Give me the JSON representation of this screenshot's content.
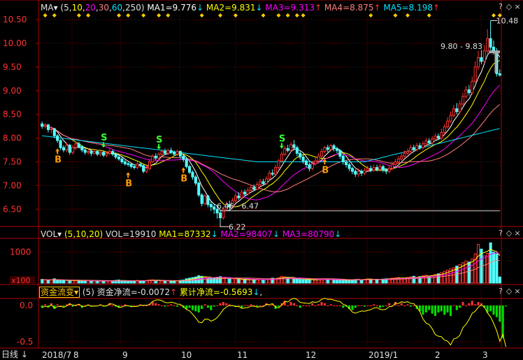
{
  "colors": {
    "bg": "#000000",
    "grid": "#7a0000",
    "axis": "#b00000",
    "up": "#ff3232",
    "down": "#54ffff",
    "ma1": "#ffffff",
    "ma2": "#ffff00",
    "ma3": "#ff00ff",
    "ma4": "#ff8080",
    "ma5": "#00e5ff",
    "buy": "#ff9900",
    "sell": "#33ff33",
    "diamond": "#ffcc00"
  },
  "price_header": {
    "indicator": "MA",
    "params_open": "(5,",
    "p1": "10",
    "p2": "20",
    "p3": "30",
    "p4": "60",
    "p5": "250)",
    "ma1": "MA1=9.776",
    "ma2": "MA2=9.831",
    "ma3": "MA3=9.313",
    "ma4": "MA4=8.875",
    "ma5": "MA5=8.198"
  },
  "vol_header": {
    "indicator": "VOL",
    "params": "(5,10,20)",
    "vol": "VOL=19910",
    "ma1": "MA1=87332",
    "ma2": "MA2=98407",
    "ma3": "MA3=80790"
  },
  "flow_header": {
    "indicator": "资金流变",
    "params": "(5)",
    "net": "资金净流=-0.0072",
    "cum": "累计净流=-0.5693"
  },
  "price_axis": [
    "10.50",
    "10.00",
    "9.50",
    "9.00",
    "8.50",
    "8.00",
    "7.50",
    "7.00",
    "6.50"
  ],
  "vol_axis": [
    "1000",
    "x100"
  ],
  "flow_axis": [
    "0.0",
    "-0.5"
  ],
  "time_axis": {
    "mode_label": "日线",
    "labels": [
      "2018/7",
      "8",
      "9",
      "10",
      "11",
      "12",
      "2019/1",
      "2",
      "3"
    ]
  },
  "annotations": {
    "high": "10.48",
    "range_high": "9.80 - 9.83",
    "range_low": "6.46 - 6.47",
    "low": "6.22"
  },
  "markers": {
    "buy": "B",
    "sell": "S"
  },
  "chart_data": {
    "type": "candlestick",
    "price_range": [
      6.15,
      10.62
    ],
    "candles": [
      [
        8.3,
        8.25,
        8.35,
        8.2
      ],
      [
        8.25,
        8.28,
        8.32,
        8.2
      ],
      [
        8.28,
        8.18,
        8.3,
        8.12
      ],
      [
        8.18,
        8.2,
        8.25,
        8.1
      ],
      [
        8.2,
        8.05,
        8.22,
        8.0
      ],
      [
        8.05,
        7.95,
        8.08,
        7.9
      ],
      [
        7.95,
        7.8,
        7.98,
        7.75
      ],
      [
        7.8,
        7.75,
        7.85,
        7.7
      ],
      [
        7.75,
        7.85,
        7.9,
        7.7
      ],
      [
        7.85,
        7.7,
        7.88,
        7.65
      ],
      [
        7.7,
        7.8,
        7.85,
        7.65
      ],
      [
        7.8,
        7.88,
        7.92,
        7.75
      ],
      [
        7.88,
        7.82,
        7.92,
        7.78
      ],
      [
        7.82,
        7.75,
        7.85,
        7.7
      ],
      [
        7.75,
        7.7,
        7.78,
        7.65
      ],
      [
        7.7,
        7.72,
        7.78,
        7.65
      ],
      [
        7.72,
        7.68,
        7.76,
        7.62
      ],
      [
        7.68,
        7.72,
        7.76,
        7.65
      ],
      [
        7.72,
        7.66,
        7.75,
        7.62
      ],
      [
        7.66,
        7.7,
        7.74,
        7.62
      ],
      [
        7.7,
        7.64,
        7.74,
        7.6
      ],
      [
        7.64,
        7.68,
        7.72,
        7.6
      ],
      [
        7.68,
        7.72,
        7.78,
        7.64
      ],
      [
        7.72,
        7.66,
        7.76,
        7.62
      ],
      [
        7.66,
        7.6,
        7.7,
        7.56
      ],
      [
        7.6,
        7.56,
        7.64,
        7.52
      ],
      [
        7.56,
        7.5,
        7.6,
        7.46
      ],
      [
        7.5,
        7.46,
        7.54,
        7.42
      ],
      [
        7.46,
        7.45,
        7.5,
        7.4
      ],
      [
        7.45,
        7.4,
        7.48,
        7.36
      ],
      [
        7.4,
        7.38,
        7.44,
        7.34
      ],
      [
        7.38,
        7.45,
        7.5,
        7.34
      ],
      [
        7.45,
        7.42,
        7.48,
        7.38
      ],
      [
        7.42,
        7.3,
        7.45,
        7.26
      ],
      [
        7.3,
        7.36,
        7.42,
        7.26
      ],
      [
        7.36,
        7.5,
        7.56,
        7.32
      ],
      [
        7.5,
        7.62,
        7.66,
        7.48
      ],
      [
        7.62,
        7.58,
        7.68,
        7.54
      ],
      [
        7.58,
        7.66,
        7.7,
        7.54
      ],
      [
        7.66,
        7.72,
        7.76,
        7.62
      ],
      [
        7.72,
        7.68,
        7.78,
        7.64
      ],
      [
        7.68,
        7.74,
        7.78,
        7.64
      ],
      [
        7.74,
        7.7,
        7.8,
        7.66
      ],
      [
        7.7,
        7.66,
        7.74,
        7.62
      ],
      [
        7.66,
        7.72,
        7.76,
        7.62
      ],
      [
        7.72,
        7.62,
        7.74,
        7.56
      ],
      [
        7.62,
        7.55,
        7.66,
        7.5
      ],
      [
        7.55,
        7.4,
        7.58,
        7.36
      ],
      [
        7.4,
        7.28,
        7.44,
        7.24
      ],
      [
        7.28,
        7.18,
        7.32,
        7.12
      ],
      [
        7.18,
        7.05,
        7.22,
        7.0
      ],
      [
        7.05,
        6.8,
        7.08,
        6.76
      ],
      [
        6.8,
        6.62,
        6.84,
        6.56
      ],
      [
        6.62,
        6.78,
        6.82,
        6.58
      ],
      [
        6.78,
        6.6,
        6.8,
        6.54
      ],
      [
        6.6,
        6.55,
        6.66,
        6.46
      ],
      [
        6.55,
        6.5,
        6.6,
        6.4
      ],
      [
        6.5,
        6.42,
        6.56,
        6.3
      ],
      [
        6.42,
        6.32,
        6.48,
        6.22
      ],
      [
        6.32,
        6.5,
        6.56,
        6.28
      ],
      [
        6.5,
        6.6,
        6.66,
        6.46
      ],
      [
        6.6,
        6.55,
        6.68,
        6.5
      ],
      [
        6.55,
        6.68,
        6.74,
        6.52
      ],
      [
        6.68,
        6.78,
        6.84,
        6.64
      ],
      [
        6.78,
        6.74,
        6.86,
        6.7
      ],
      [
        6.74,
        6.86,
        6.92,
        6.72
      ],
      [
        6.86,
        6.82,
        6.92,
        6.78
      ],
      [
        6.82,
        6.9,
        6.96,
        6.78
      ],
      [
        6.9,
        6.96,
        7.02,
        6.86
      ],
      [
        6.96,
        6.92,
        7.02,
        6.88
      ],
      [
        6.92,
        7.02,
        7.08,
        6.9
      ],
      [
        7.02,
        7.08,
        7.14,
        6.98
      ],
      [
        7.08,
        7.04,
        7.14,
        7.0
      ],
      [
        7.04,
        7.14,
        7.2,
        7.02
      ],
      [
        7.14,
        7.26,
        7.32,
        7.1
      ],
      [
        7.26,
        7.24,
        7.34,
        7.2
      ],
      [
        7.24,
        7.38,
        7.44,
        7.2
      ],
      [
        7.38,
        7.52,
        7.56,
        7.34
      ],
      [
        7.52,
        7.66,
        7.72,
        7.48
      ],
      [
        7.66,
        7.78,
        7.84,
        7.62
      ],
      [
        7.78,
        7.74,
        7.86,
        7.7
      ],
      [
        7.74,
        7.86,
        7.92,
        7.7
      ],
      [
        7.86,
        7.8,
        7.96,
        7.74
      ],
      [
        7.8,
        7.68,
        7.84,
        7.62
      ],
      [
        7.68,
        7.6,
        7.72,
        7.54
      ],
      [
        7.6,
        7.52,
        7.66,
        7.46
      ],
      [
        7.52,
        7.44,
        7.56,
        7.38
      ],
      [
        7.44,
        7.36,
        7.48,
        7.3
      ],
      [
        7.36,
        7.46,
        7.52,
        7.32
      ],
      [
        7.46,
        7.52,
        7.58,
        7.42
      ],
      [
        7.52,
        7.62,
        7.68,
        7.48
      ],
      [
        7.62,
        7.72,
        7.78,
        7.58
      ],
      [
        7.72,
        7.8,
        7.84,
        7.68
      ],
      [
        7.8,
        7.76,
        7.86,
        7.7
      ],
      [
        7.76,
        7.84,
        7.88,
        7.72
      ],
      [
        7.84,
        7.78,
        7.88,
        7.72
      ],
      [
        7.78,
        7.74,
        7.82,
        7.68
      ],
      [
        7.74,
        7.62,
        7.76,
        7.56
      ],
      [
        7.62,
        7.5,
        7.66,
        7.44
      ],
      [
        7.5,
        7.44,
        7.54,
        7.38
      ],
      [
        7.44,
        7.36,
        7.48,
        7.3
      ],
      [
        7.36,
        7.3,
        7.4,
        7.24
      ],
      [
        7.3,
        7.24,
        7.34,
        7.18
      ],
      [
        7.24,
        7.3,
        7.36,
        7.18
      ],
      [
        7.3,
        7.26,
        7.34,
        7.2
      ],
      [
        7.26,
        7.32,
        7.38,
        7.22
      ],
      [
        7.32,
        7.36,
        7.42,
        7.28
      ],
      [
        7.36,
        7.32,
        7.42,
        7.28
      ],
      [
        7.32,
        7.38,
        7.44,
        7.28
      ],
      [
        7.38,
        7.34,
        7.44,
        7.3
      ],
      [
        7.34,
        7.4,
        7.46,
        7.3
      ],
      [
        7.4,
        7.32,
        7.44,
        7.28
      ],
      [
        7.32,
        7.3,
        7.36,
        7.24
      ],
      [
        7.3,
        7.36,
        7.42,
        7.26
      ],
      [
        7.36,
        7.44,
        7.5,
        7.32
      ],
      [
        7.44,
        7.5,
        7.56,
        7.4
      ],
      [
        7.5,
        7.56,
        7.62,
        7.46
      ],
      [
        7.56,
        7.62,
        7.68,
        7.52
      ],
      [
        7.62,
        7.68,
        7.74,
        7.58
      ],
      [
        7.68,
        7.72,
        7.78,
        7.64
      ],
      [
        7.72,
        7.8,
        7.86,
        7.68
      ],
      [
        7.8,
        7.76,
        7.86,
        7.72
      ],
      [
        7.76,
        7.84,
        7.9,
        7.72
      ],
      [
        7.84,
        7.8,
        7.9,
        7.76
      ],
      [
        7.8,
        7.88,
        7.94,
        7.76
      ],
      [
        7.88,
        7.94,
        8.0,
        7.84
      ],
      [
        7.94,
        7.9,
        8.0,
        7.86
      ],
      [
        7.9,
        7.98,
        8.04,
        7.86
      ],
      [
        7.98,
        8.04,
        8.1,
        7.94
      ],
      [
        8.04,
        8.0,
        8.1,
        7.96
      ],
      [
        8.0,
        8.12,
        8.2,
        7.96
      ],
      [
        8.12,
        8.24,
        8.3,
        8.08
      ],
      [
        8.24,
        8.36,
        8.44,
        8.2
      ],
      [
        8.36,
        8.48,
        8.56,
        8.32
      ],
      [
        8.48,
        8.62,
        8.7,
        8.44
      ],
      [
        8.62,
        8.56,
        8.74,
        8.5
      ],
      [
        8.56,
        8.72,
        8.8,
        8.52
      ],
      [
        8.72,
        8.88,
        8.96,
        8.68
      ],
      [
        8.88,
        9.02,
        9.1,
        8.84
      ],
      [
        9.02,
        8.96,
        9.12,
        8.9
      ],
      [
        8.96,
        9.2,
        9.3,
        8.92
      ],
      [
        9.2,
        9.5,
        9.62,
        9.16
      ],
      [
        9.5,
        9.7,
        9.84,
        9.44
      ],
      [
        9.7,
        9.62,
        9.86,
        9.56
      ],
      [
        9.62,
        9.84,
        9.96,
        9.58
      ],
      [
        9.84,
        10.1,
        10.3,
        9.78
      ],
      [
        10.1,
        9.92,
        10.48,
        9.86
      ],
      [
        9.92,
        9.84,
        10.06,
        9.76
      ],
      [
        9.84,
        9.36,
        9.9,
        9.3
      ],
      [
        9.36,
        9.33,
        9.45,
        9.3
      ]
    ],
    "volume": [
      12,
      10,
      9,
      11,
      14,
      10,
      8,
      9,
      8,
      7,
      9,
      8,
      7,
      8,
      9,
      7,
      6,
      7,
      8,
      6,
      7,
      6,
      7,
      8,
      9,
      10,
      8,
      7,
      6,
      8,
      7,
      9,
      6,
      8,
      9,
      10,
      11,
      9,
      8,
      7,
      8,
      7,
      6,
      7,
      8,
      9,
      10,
      14,
      16,
      18,
      20,
      24,
      22,
      18,
      16,
      15,
      17,
      19,
      21,
      18,
      16,
      15,
      14,
      13,
      12,
      11,
      12,
      10,
      11,
      12,
      13,
      11,
      10,
      12,
      14,
      16,
      15,
      18,
      22,
      20,
      18,
      16,
      15,
      14,
      12,
      11,
      10,
      12,
      11,
      10,
      12,
      13,
      14,
      12,
      11,
      10,
      9,
      10,
      11,
      9,
      10,
      11,
      12,
      13,
      11,
      12,
      14,
      13,
      12,
      11,
      12,
      13,
      14,
      15,
      16,
      17,
      18,
      16,
      17,
      18,
      20,
      22,
      19,
      21,
      24,
      26,
      23,
      25,
      28,
      30,
      34,
      38,
      42,
      46,
      50,
      55,
      60,
      66,
      72,
      68,
      78,
      95,
      125,
      110,
      88,
      96,
      130,
      100,
      95,
      20
    ],
    "volume_max": 1400,
    "flow": [
      -0.02,
      0.01,
      -0.01,
      0.02,
      -0.03,
      0.01,
      0.0,
      -0.01,
      0.01,
      0.02,
      -0.01,
      0.0,
      0.01,
      -0.02,
      0.0,
      0.01,
      -0.01,
      0.0,
      0.0,
      0.01,
      -0.01,
      0.0,
      0.02,
      0.0,
      -0.01,
      -0.02,
      0.0,
      0.01,
      0.0,
      -0.01,
      0.0,
      0.0,
      0.01,
      0.0,
      0.0,
      0.01,
      0.03,
      0.02,
      0.01,
      0.0,
      -0.01,
      0.0,
      0.01,
      0.0,
      -0.01,
      0.0,
      -0.02,
      -0.03,
      -0.02,
      -0.04,
      -0.05,
      -0.06,
      -0.03,
      0.01,
      -0.02,
      -0.04,
      -0.01,
      0.0,
      0.02,
      0.03,
      0.02,
      0.01,
      0.0,
      -0.01,
      0.0,
      -0.02,
      0.0,
      0.0,
      0.01,
      0.0,
      -0.01,
      0.0,
      0.0,
      0.02,
      0.0,
      0.01,
      -0.03,
      -0.01,
      0.02,
      0.04,
      0.0,
      0.03,
      0.02,
      0.0,
      -0.02,
      0.0,
      0.0,
      0.0,
      0.02,
      0.0,
      0.01,
      0.03,
      0.02,
      0.0,
      0.01,
      0.0,
      0.0,
      0.0,
      -0.02,
      -0.01,
      -0.03,
      -0.04,
      -0.02,
      0.0,
      0.0,
      -0.01,
      0.0,
      0.0,
      0.01,
      0.0,
      -0.02,
      -0.01,
      0.0,
      0.02,
      0.0,
      0.03,
      0.0,
      0.02,
      0.0,
      0.01,
      -0.01,
      0.0,
      -0.03,
      -0.05,
      -0.08,
      -0.06,
      -0.04,
      -0.07,
      -0.09,
      -0.06,
      -0.05,
      -0.08,
      -0.06,
      -0.09,
      0.0,
      -0.04,
      -0.02,
      0.03,
      0.0,
      0.02,
      0.04,
      0.01,
      0.03,
      0.02,
      -0.02,
      -0.06,
      -0.05,
      -0.08,
      -0.1,
      -0.14,
      -0.28,
      -0.0072
    ],
    "buy_signals": [
      5,
      28,
      46,
      92
    ],
    "sell_signals": [
      20,
      38,
      78
    ],
    "diamonds_top": [
      1,
      4,
      12,
      15,
      25,
      28,
      33,
      38,
      41,
      52,
      58,
      63,
      72,
      77,
      80,
      83,
      85,
      107,
      115,
      119,
      126,
      147,
      149
    ]
  }
}
